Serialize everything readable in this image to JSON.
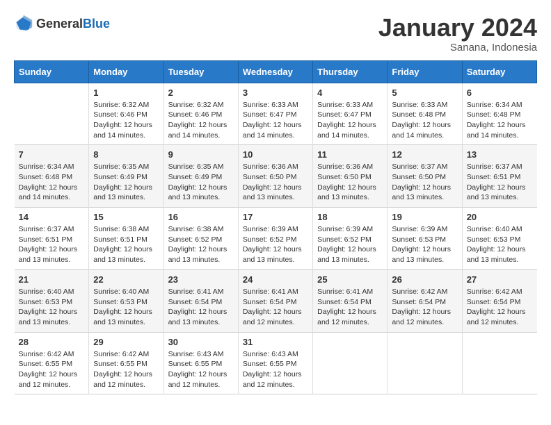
{
  "header": {
    "logo_general": "General",
    "logo_blue": "Blue",
    "month_year": "January 2024",
    "location": "Sanana, Indonesia"
  },
  "weekdays": [
    "Sunday",
    "Monday",
    "Tuesday",
    "Wednesday",
    "Thursday",
    "Friday",
    "Saturday"
  ],
  "weeks": [
    [
      {
        "day": "",
        "sunrise": "",
        "sunset": "",
        "daylight": ""
      },
      {
        "day": "1",
        "sunrise": "Sunrise: 6:32 AM",
        "sunset": "Sunset: 6:46 PM",
        "daylight": "Daylight: 12 hours and 14 minutes."
      },
      {
        "day": "2",
        "sunrise": "Sunrise: 6:32 AM",
        "sunset": "Sunset: 6:46 PM",
        "daylight": "Daylight: 12 hours and 14 minutes."
      },
      {
        "day": "3",
        "sunrise": "Sunrise: 6:33 AM",
        "sunset": "Sunset: 6:47 PM",
        "daylight": "Daylight: 12 hours and 14 minutes."
      },
      {
        "day": "4",
        "sunrise": "Sunrise: 6:33 AM",
        "sunset": "Sunset: 6:47 PM",
        "daylight": "Daylight: 12 hours and 14 minutes."
      },
      {
        "day": "5",
        "sunrise": "Sunrise: 6:33 AM",
        "sunset": "Sunset: 6:48 PM",
        "daylight": "Daylight: 12 hours and 14 minutes."
      },
      {
        "day": "6",
        "sunrise": "Sunrise: 6:34 AM",
        "sunset": "Sunset: 6:48 PM",
        "daylight": "Daylight: 12 hours and 14 minutes."
      }
    ],
    [
      {
        "day": "7",
        "sunrise": "Sunrise: 6:34 AM",
        "sunset": "Sunset: 6:48 PM",
        "daylight": "Daylight: 12 hours and 14 minutes."
      },
      {
        "day": "8",
        "sunrise": "Sunrise: 6:35 AM",
        "sunset": "Sunset: 6:49 PM",
        "daylight": "Daylight: 12 hours and 13 minutes."
      },
      {
        "day": "9",
        "sunrise": "Sunrise: 6:35 AM",
        "sunset": "Sunset: 6:49 PM",
        "daylight": "Daylight: 12 hours and 13 minutes."
      },
      {
        "day": "10",
        "sunrise": "Sunrise: 6:36 AM",
        "sunset": "Sunset: 6:50 PM",
        "daylight": "Daylight: 12 hours and 13 minutes."
      },
      {
        "day": "11",
        "sunrise": "Sunrise: 6:36 AM",
        "sunset": "Sunset: 6:50 PM",
        "daylight": "Daylight: 12 hours and 13 minutes."
      },
      {
        "day": "12",
        "sunrise": "Sunrise: 6:37 AM",
        "sunset": "Sunset: 6:50 PM",
        "daylight": "Daylight: 12 hours and 13 minutes."
      },
      {
        "day": "13",
        "sunrise": "Sunrise: 6:37 AM",
        "sunset": "Sunset: 6:51 PM",
        "daylight": "Daylight: 12 hours and 13 minutes."
      }
    ],
    [
      {
        "day": "14",
        "sunrise": "Sunrise: 6:37 AM",
        "sunset": "Sunset: 6:51 PM",
        "daylight": "Daylight: 12 hours and 13 minutes."
      },
      {
        "day": "15",
        "sunrise": "Sunrise: 6:38 AM",
        "sunset": "Sunset: 6:51 PM",
        "daylight": "Daylight: 12 hours and 13 minutes."
      },
      {
        "day": "16",
        "sunrise": "Sunrise: 6:38 AM",
        "sunset": "Sunset: 6:52 PM",
        "daylight": "Daylight: 12 hours and 13 minutes."
      },
      {
        "day": "17",
        "sunrise": "Sunrise: 6:39 AM",
        "sunset": "Sunset: 6:52 PM",
        "daylight": "Daylight: 12 hours and 13 minutes."
      },
      {
        "day": "18",
        "sunrise": "Sunrise: 6:39 AM",
        "sunset": "Sunset: 6:52 PM",
        "daylight": "Daylight: 12 hours and 13 minutes."
      },
      {
        "day": "19",
        "sunrise": "Sunrise: 6:39 AM",
        "sunset": "Sunset: 6:53 PM",
        "daylight": "Daylight: 12 hours and 13 minutes."
      },
      {
        "day": "20",
        "sunrise": "Sunrise: 6:40 AM",
        "sunset": "Sunset: 6:53 PM",
        "daylight": "Daylight: 12 hours and 13 minutes."
      }
    ],
    [
      {
        "day": "21",
        "sunrise": "Sunrise: 6:40 AM",
        "sunset": "Sunset: 6:53 PM",
        "daylight": "Daylight: 12 hours and 13 minutes."
      },
      {
        "day": "22",
        "sunrise": "Sunrise: 6:40 AM",
        "sunset": "Sunset: 6:53 PM",
        "daylight": "Daylight: 12 hours and 13 minutes."
      },
      {
        "day": "23",
        "sunrise": "Sunrise: 6:41 AM",
        "sunset": "Sunset: 6:54 PM",
        "daylight": "Daylight: 12 hours and 13 minutes."
      },
      {
        "day": "24",
        "sunrise": "Sunrise: 6:41 AM",
        "sunset": "Sunset: 6:54 PM",
        "daylight": "Daylight: 12 hours and 12 minutes."
      },
      {
        "day": "25",
        "sunrise": "Sunrise: 6:41 AM",
        "sunset": "Sunset: 6:54 PM",
        "daylight": "Daylight: 12 hours and 12 minutes."
      },
      {
        "day": "26",
        "sunrise": "Sunrise: 6:42 AM",
        "sunset": "Sunset: 6:54 PM",
        "daylight": "Daylight: 12 hours and 12 minutes."
      },
      {
        "day": "27",
        "sunrise": "Sunrise: 6:42 AM",
        "sunset": "Sunset: 6:54 PM",
        "daylight": "Daylight: 12 hours and 12 minutes."
      }
    ],
    [
      {
        "day": "28",
        "sunrise": "Sunrise: 6:42 AM",
        "sunset": "Sunset: 6:55 PM",
        "daylight": "Daylight: 12 hours and 12 minutes."
      },
      {
        "day": "29",
        "sunrise": "Sunrise: 6:42 AM",
        "sunset": "Sunset: 6:55 PM",
        "daylight": "Daylight: 12 hours and 12 minutes."
      },
      {
        "day": "30",
        "sunrise": "Sunrise: 6:43 AM",
        "sunset": "Sunset: 6:55 PM",
        "daylight": "Daylight: 12 hours and 12 minutes."
      },
      {
        "day": "31",
        "sunrise": "Sunrise: 6:43 AM",
        "sunset": "Sunset: 6:55 PM",
        "daylight": "Daylight: 12 hours and 12 minutes."
      },
      {
        "day": "",
        "sunrise": "",
        "sunset": "",
        "daylight": ""
      },
      {
        "day": "",
        "sunrise": "",
        "sunset": "",
        "daylight": ""
      },
      {
        "day": "",
        "sunrise": "",
        "sunset": "",
        "daylight": ""
      }
    ]
  ]
}
